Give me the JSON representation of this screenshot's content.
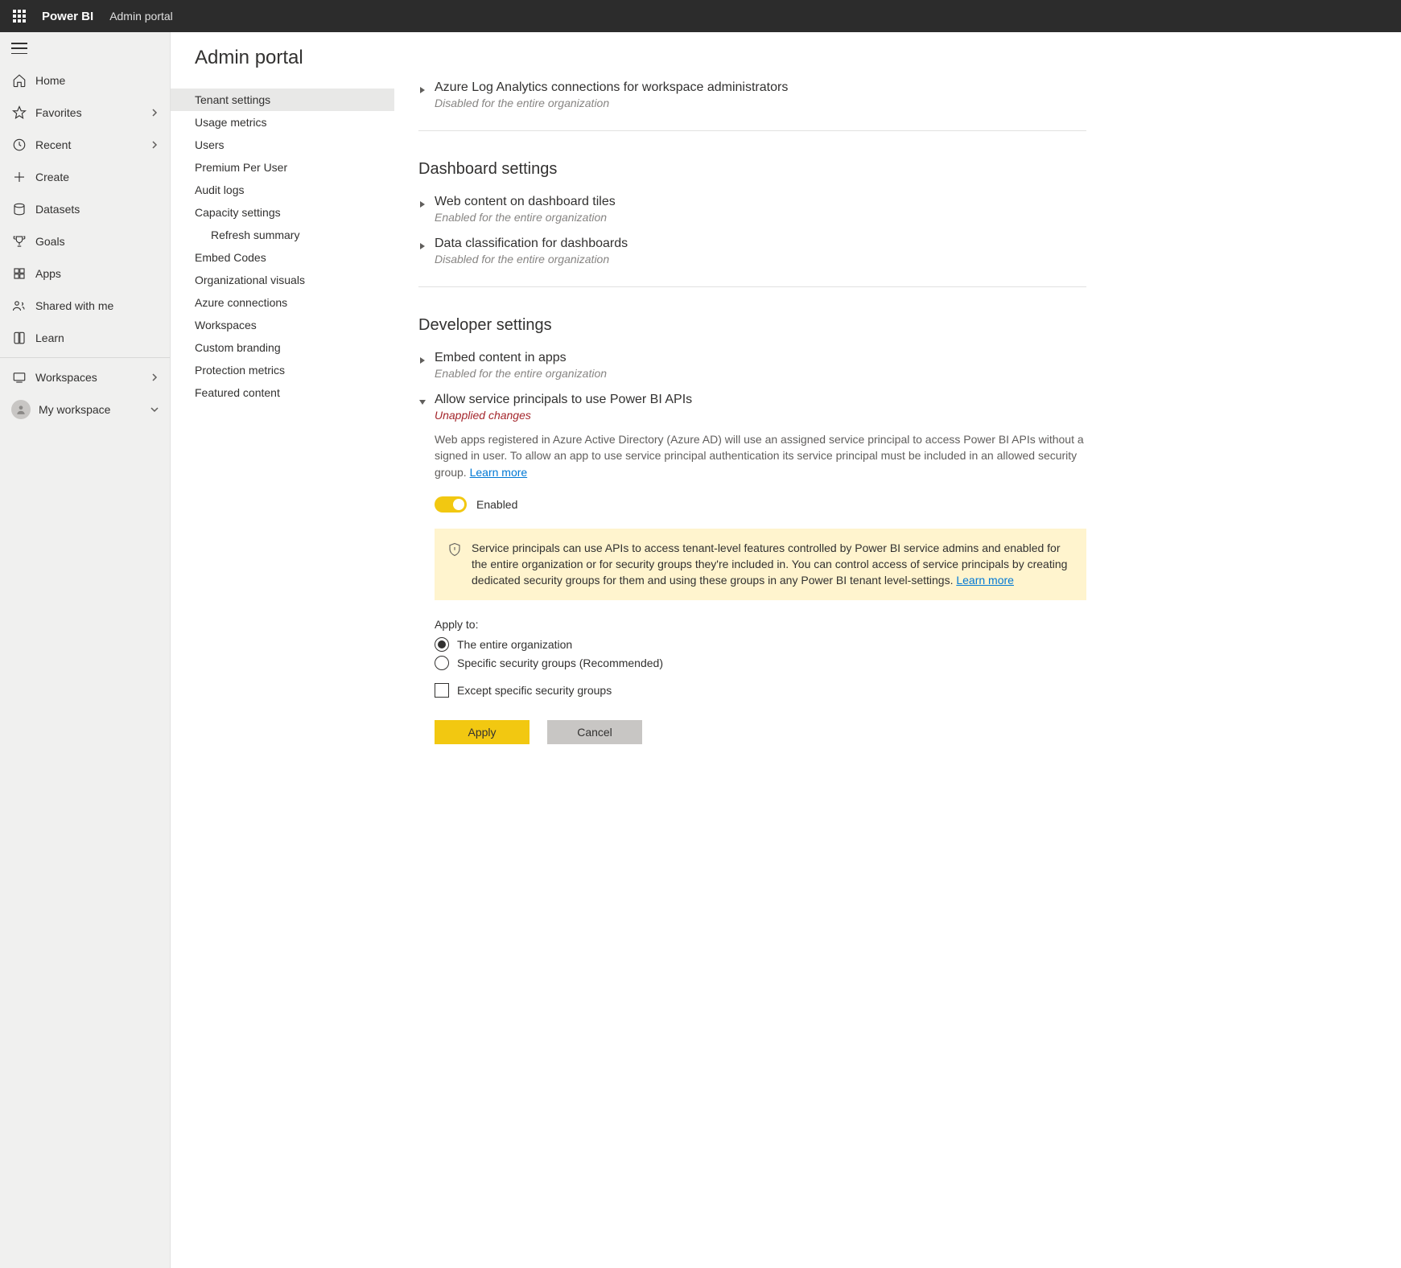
{
  "header": {
    "app": "Power BI",
    "page": "Admin portal"
  },
  "nav": {
    "home": "Home",
    "favorites": "Favorites",
    "recent": "Recent",
    "create": "Create",
    "datasets": "Datasets",
    "goals": "Goals",
    "apps": "Apps",
    "shared": "Shared with me",
    "learn": "Learn",
    "workspaces": "Workspaces",
    "myworkspace": "My workspace"
  },
  "admin": {
    "title": "Admin portal",
    "items": [
      "Tenant settings",
      "Usage metrics",
      "Users",
      "Premium Per User",
      "Audit logs",
      "Capacity settings",
      "Refresh summary",
      "Embed Codes",
      "Organizational visuals",
      "Azure connections",
      "Workspaces",
      "Custom branding",
      "Protection metrics",
      "Featured content"
    ]
  },
  "content": {
    "setting0": {
      "title": "Azure Log Analytics connections for workspace administrators",
      "sub": "Disabled for the entire organization"
    },
    "group1": "Dashboard settings",
    "setting1a": {
      "title": "Web content on dashboard tiles",
      "sub": "Enabled for the entire organization"
    },
    "setting1b": {
      "title": "Data classification for dashboards",
      "sub": "Disabled for the entire organization"
    },
    "group2": "Developer settings",
    "setting2a": {
      "title": "Embed content in apps",
      "sub": "Enabled for the entire organization"
    },
    "setting2b": {
      "title": "Allow service principals to use Power BI APIs",
      "unapplied": "Unapplied changes",
      "desc": "Web apps registered in Azure Active Directory (Azure AD) will use an assigned service principal to access Power BI APIs without a signed in user. To allow an app to use service principal authentication its service principal must be included in an allowed security group.",
      "learn": "Learn more",
      "toggle_label": "Enabled",
      "warn": "Service principals can use APIs to access tenant-level features controlled by Power BI service admins and enabled for the entire organization or for security groups they're included in. You can control access of service principals by creating dedicated security groups for them and using these groups in any Power BI tenant level-settings.",
      "warn_learn": "Learn more",
      "apply_to": "Apply to:",
      "radio1": "The entire organization",
      "radio2": "Specific security groups (Recommended)",
      "checkbox": "Except specific security groups",
      "apply_btn": "Apply",
      "cancel_btn": "Cancel"
    }
  }
}
